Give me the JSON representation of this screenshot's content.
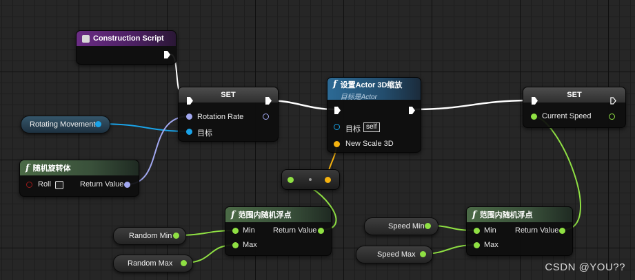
{
  "nodes": {
    "construction_script": {
      "title": "Construction Script",
      "icon": "event-icon",
      "color": "#6a2c84"
    },
    "set_rotation": {
      "title": "SET",
      "pin_rotation_rate": "Rotation Rate",
      "pin_target": "目标"
    },
    "set_actor_scale": {
      "title": "设置Actor 3D缩放",
      "subtitle": "目标是Actor",
      "pin_target": "目标",
      "self_value": "self",
      "pin_new_scale": "New Scale 3D"
    },
    "set_speed": {
      "title": "SET",
      "pin_current_speed": "Current Speed"
    },
    "random_rotator": {
      "title": "随机旋转体",
      "pin_roll": "Roll",
      "pin_return": "Return Value"
    },
    "random_float_left": {
      "title": "范围内随机浮点",
      "pin_min": "Min",
      "pin_max": "Max",
      "pin_return": "Return Value"
    },
    "random_float_right": {
      "title": "范围内随机浮点",
      "pin_min": "Min",
      "pin_max": "Max",
      "pin_return": "Return Value"
    }
  },
  "variables": {
    "rotating_movement": "Rotating Movement",
    "random_min": "Random Min",
    "random_max": "Random Max",
    "speed_min": "Speed Min",
    "speed_max": "Speed Max"
  },
  "colors": {
    "exec": "#ffffff",
    "float": "#8fe043",
    "rotator": "#a2a8f0",
    "object": "#1aa3e8",
    "vector": "#f5b20f",
    "boolean": "#9b1a1a"
  },
  "watermark": "CSDN @YOU??"
}
